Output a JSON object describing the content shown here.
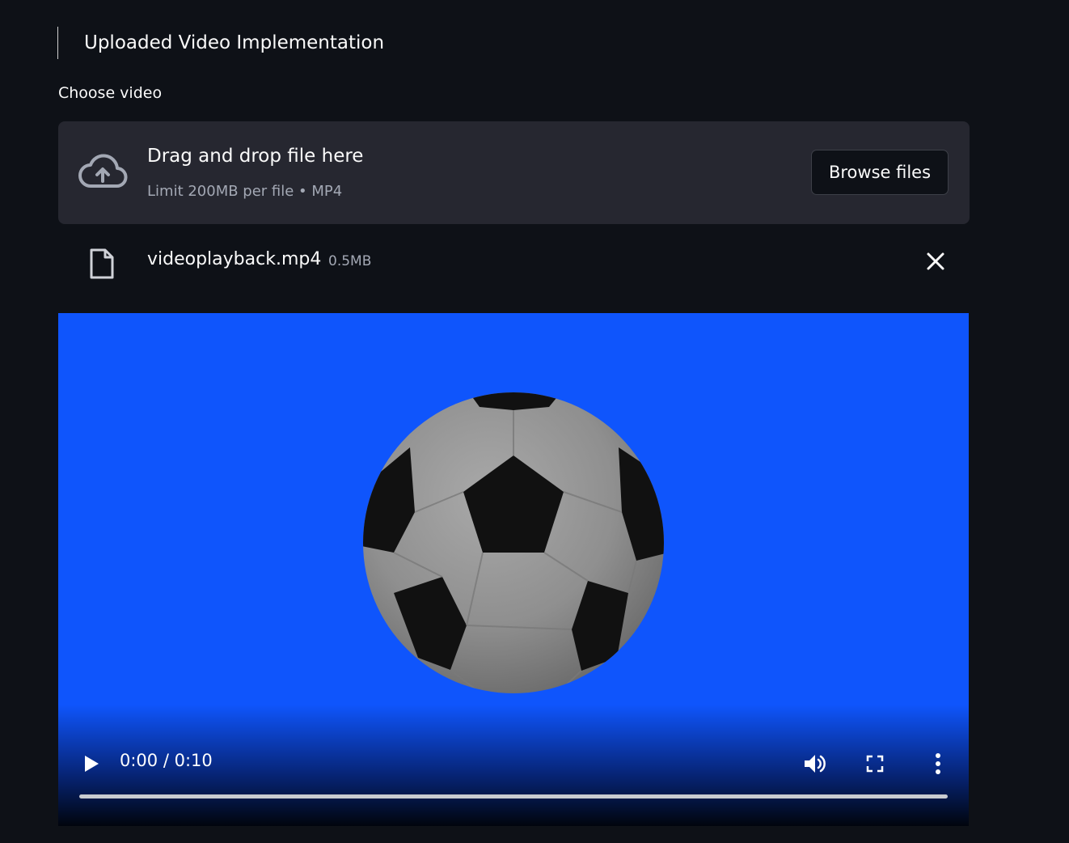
{
  "header": {
    "title": "Uploaded Video Implementation"
  },
  "uploader": {
    "label": "Choose video",
    "dropzone_title": "Drag and drop file here",
    "dropzone_subtitle": "Limit 200MB per file • MP4",
    "browse_label": "Browse files",
    "cloud_icon": "cloud-upload-icon"
  },
  "file": {
    "name": "videoplayback.mp4",
    "size": "0.5MB",
    "file_icon": "file-icon",
    "remove_icon": "close-icon"
  },
  "video": {
    "time": "0:00 / 0:10",
    "progress": 0,
    "background_color": "#0f55fc",
    "icons": [
      "play-icon",
      "volume-icon",
      "fullscreen-icon",
      "more-vertical-icon"
    ]
  }
}
